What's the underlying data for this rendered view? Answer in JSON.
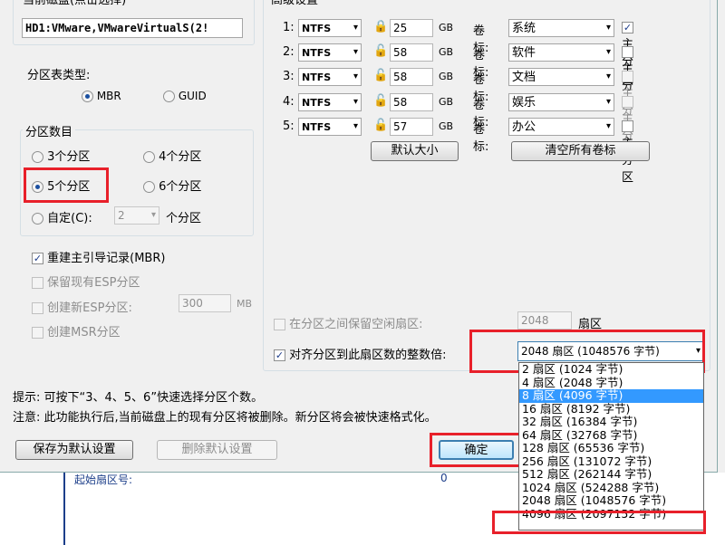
{
  "disk": {
    "group_label": "当前磁盘(点击选择)",
    "value": "HD1:VMware,VMwareVirtualS(2!"
  },
  "table_type": {
    "label": "分区表类型:",
    "options": [
      {
        "label": "MBR",
        "selected": true
      },
      {
        "label": "GUID",
        "selected": false
      }
    ]
  },
  "partition_count": {
    "group_label": "分区数目",
    "options": [
      "3个分区",
      "4个分区",
      "5个分区",
      "6个分区"
    ],
    "selected": "5个分区",
    "custom_label": "自定(C):",
    "custom_value": "2",
    "custom_suffix": "个分区"
  },
  "options": {
    "rebuild_mbr": "重建主引导记录(MBR)",
    "keep_esp": "保留现有ESP分区",
    "create_esp": "创建新ESP分区:",
    "esp_size": "300",
    "esp_unit": "MB",
    "create_msr": "创建MSR分区"
  },
  "advanced": {
    "group_label": "高级设置",
    "rows": [
      {
        "index": "1:",
        "fs": "NTFS",
        "size": "25",
        "unit": "GB",
        "vol_label": "卷标:",
        "volume": "系统",
        "primary": "主分区",
        "primary_checked": true,
        "primary_enabled": true
      },
      {
        "index": "2:",
        "fs": "NTFS",
        "size": "58",
        "unit": "GB",
        "vol_label": "卷标:",
        "volume": "软件",
        "primary": "主分区",
        "primary_checked": false,
        "primary_enabled": true
      },
      {
        "index": "3:",
        "fs": "NTFS",
        "size": "58",
        "unit": "GB",
        "vol_label": "卷标:",
        "volume": "文档",
        "primary": "主分区",
        "primary_checked": false,
        "primary_enabled": false
      },
      {
        "index": "4:",
        "fs": "NTFS",
        "size": "58",
        "unit": "GB",
        "vol_label": "卷标:",
        "volume": "娱乐",
        "primary": "主分区",
        "primary_checked": false,
        "primary_enabled": false
      },
      {
        "index": "5:",
        "fs": "NTFS",
        "size": "57",
        "unit": "GB",
        "vol_label": "卷标:",
        "volume": "办公",
        "primary": "主分区",
        "primary_checked": false,
        "primary_enabled": true
      }
    ],
    "default_size_button": "默认大小",
    "clear_labels_button": "清空所有卷标",
    "reserve_free_label": "在分区之间保留空闲扇区:",
    "reserve_free_value": "2048",
    "reserve_free_unit": "扇区",
    "align_label": "对齐分区到此扇区数的整数倍:",
    "align_value": "2048 扇区 (1048576 字节)"
  },
  "align_dropdown": [
    {
      "label": "2 扇区 (1024 字节)",
      "selected": false
    },
    {
      "label": "4 扇区 (2048 字节)",
      "selected": false
    },
    {
      "label": "8 扇区 (4096 字节)",
      "selected": true
    },
    {
      "label": "16 扇区 (8192 字节)",
      "selected": false
    },
    {
      "label": "32 扇区 (16384 字节)",
      "selected": false
    },
    {
      "label": "64 扇区 (32768 字节)",
      "selected": false
    },
    {
      "label": "128 扇区 (65536 字节)",
      "selected": false
    },
    {
      "label": "256 扇区 (131072 字节)",
      "selected": false
    },
    {
      "label": "512 扇区 (262144 字节)",
      "selected": false
    },
    {
      "label": "1024 扇区 (524288 字节)",
      "selected": false
    },
    {
      "label": "2048 扇区 (1048576 字节)",
      "selected": false
    },
    {
      "label": "4096 扇区 (2097152 字节)",
      "selected": false
    }
  ],
  "hints": {
    "hint1": "提示: 可按下“3、4、5、6”快速选择分区个数。",
    "hint2": "注意: 此功能执行后,当前磁盘上的现有分区将被删除。新分区将会被快速格式化。"
  },
  "buttons": {
    "save_default": "保存为默认设置",
    "delete_default": "删除默认设置",
    "ok": "确定"
  },
  "background": {
    "start_sector_label": "起始扇区号:",
    "start_sector_value": "0"
  },
  "colors": {
    "highlight": "#e8202a",
    "selection": "#3399ff"
  }
}
